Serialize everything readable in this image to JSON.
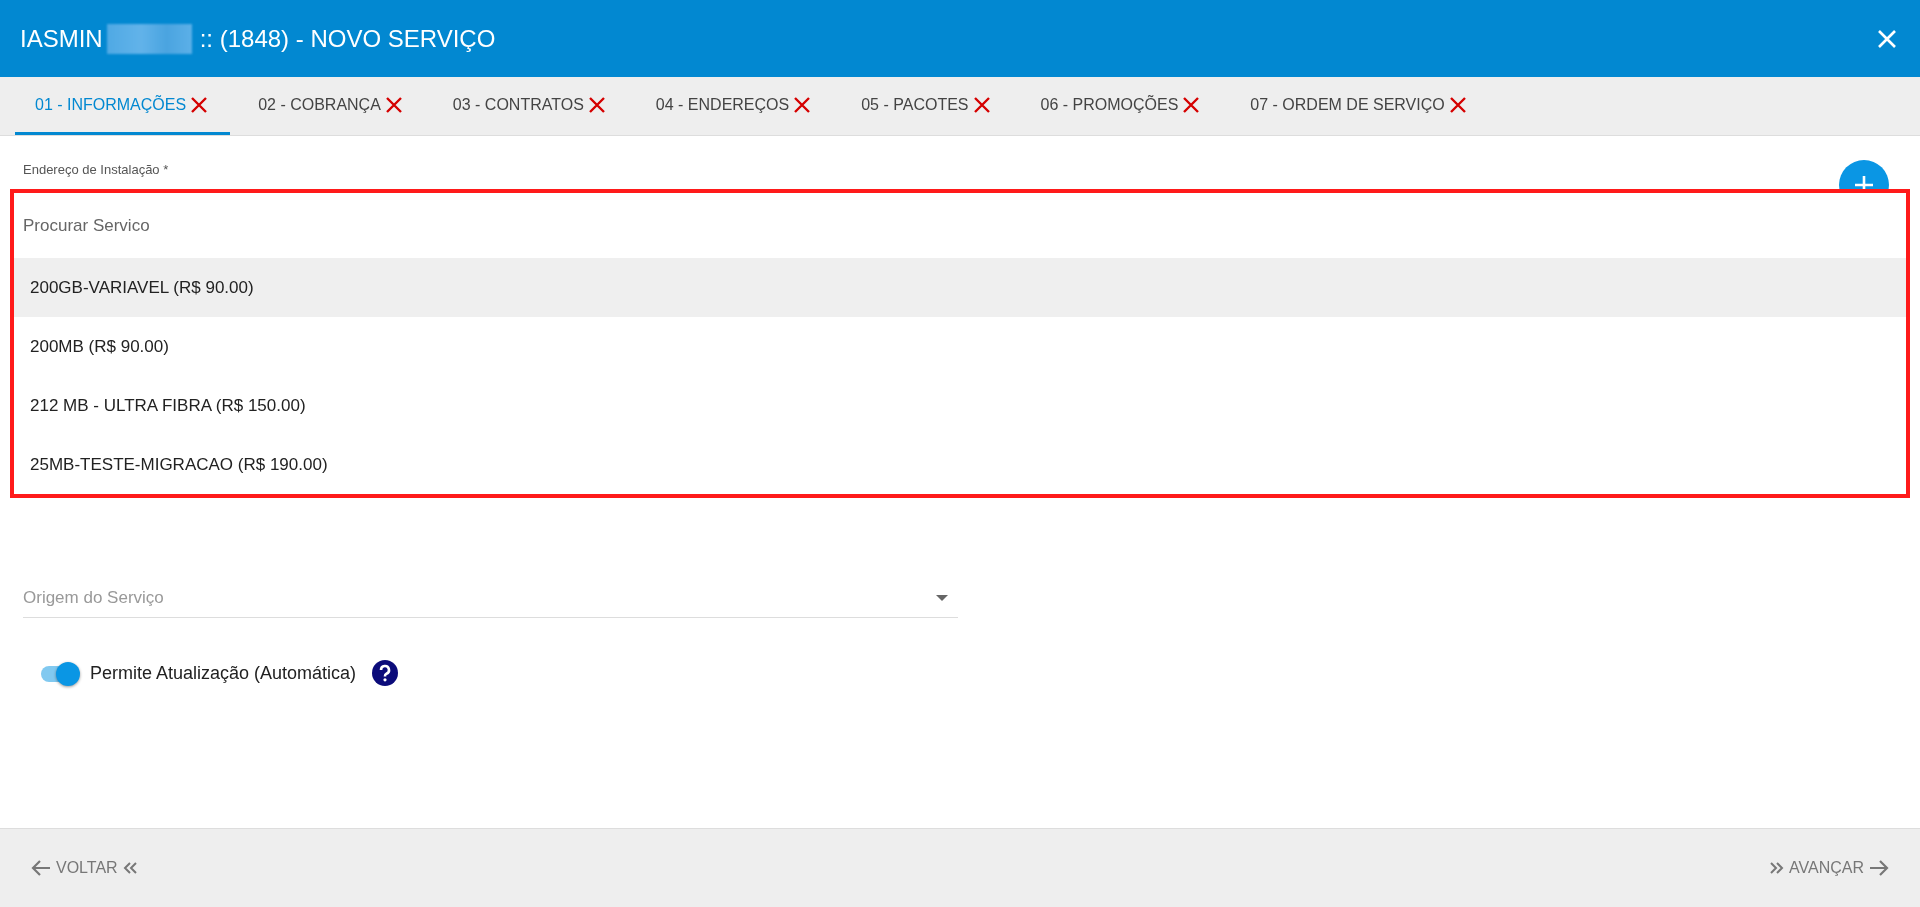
{
  "window": {
    "title_name": "IASMIN",
    "title": ":: (1848) - NOVO SERVIÇO"
  },
  "tabs": [
    {
      "label": "01 - INFORMAÇÕES",
      "selected": true,
      "error": true
    },
    {
      "label": "02 - COBRANÇA",
      "selected": false,
      "error": true
    },
    {
      "label": "03 - CONTRATOS",
      "selected": false,
      "error": true
    },
    {
      "label": "04 - ENDEREÇOS",
      "selected": false,
      "error": true
    },
    {
      "label": "05 - PACOTES",
      "selected": false,
      "error": true
    },
    {
      "label": "06 - PROMOÇÕES",
      "selected": false,
      "error": true
    },
    {
      "label": "07 - ORDEM DE SERVIÇO",
      "selected": false,
      "error": true
    }
  ],
  "address_field": {
    "label": "Endereço de Instalação *"
  },
  "service_dropdown": {
    "placeholder": "Procurar Servico",
    "options": [
      {
        "label": "200GB-VARIAVEL (R$ 90.00)",
        "selected": true
      },
      {
        "label": "200MB (R$ 90.00)",
        "selected": false
      },
      {
        "label": "212 MB - ULTRA FIBRA (R$ 150.00)",
        "selected": false
      },
      {
        "label": "25MB-TESTE-MIGRACAO (R$ 190.00)",
        "selected": false
      }
    ]
  },
  "origin_field": {
    "placeholder": "Origem do Serviço"
  },
  "auto_update": {
    "label": "Permite Atualização (Automática)",
    "on": true
  },
  "footer": {
    "back": "VOLTAR",
    "next": "AVANÇAR"
  }
}
